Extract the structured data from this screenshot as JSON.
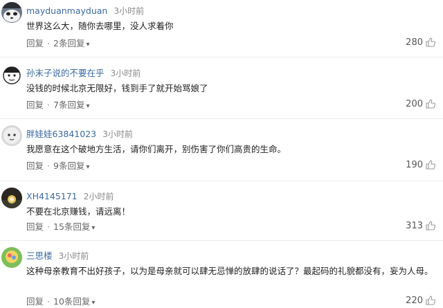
{
  "comments": [
    {
      "username": "mayduanmayduan",
      "time": "3小时前",
      "content": "世界这么大，随你去哪里，没人求着你",
      "reply_label": "回复",
      "reply_count": "2条回复",
      "likes": "280",
      "avatar": "panda-avatar"
    },
    {
      "username": "孙末子说的不要在乎",
      "time": "3小时前",
      "content": "没钱的时候北京无限好，钱到手了就开始骂娘了",
      "reply_label": "回复",
      "reply_count": "7条回复",
      "likes": "200",
      "avatar": "cartoon-face-avatar"
    },
    {
      "username": "胖娃娃63841023",
      "time": "3小时前",
      "content": "我愿意在这个破地方生活，请你们离开，别伤害了你们高贵的生命。",
      "reply_label": "回复",
      "reply_count": "9条回复",
      "likes": "190",
      "avatar": "gray-face-avatar"
    },
    {
      "username": "XH4145171",
      "time": "2小时前",
      "content": "不要在北京赚钱，请远离！",
      "reply_label": "回复",
      "reply_count": "15条回复",
      "likes": "313",
      "avatar": "sunset-avatar"
    },
    {
      "username": "三思楼",
      "time": "3小时前",
      "content": "这种母亲教育不出好孩子，以为是母亲就可以肆无忌惮的放肆的说话了？最起码的礼貌都没有，妄为人母。",
      "reply_label": "回复",
      "reply_count": "10条回复",
      "likes": "220",
      "avatar": "colorful-avatar"
    }
  ]
}
